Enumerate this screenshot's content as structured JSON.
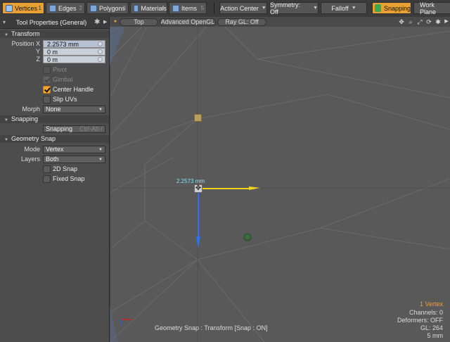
{
  "toolbar": {
    "tabs": [
      {
        "label": "Vertices",
        "num": "1"
      },
      {
        "label": "Edges",
        "num": "2"
      },
      {
        "label": "Polygons",
        "num": "3"
      },
      {
        "label": "Materials",
        "num": "4"
      },
      {
        "label": "Items",
        "num": "5"
      }
    ],
    "action_center": "Action Center",
    "symmetry": "Symmetry: Off",
    "falloff": "Falloff",
    "snapping": "Snapping",
    "work_plane": "Work Plane"
  },
  "panel": {
    "title": "Tool Properties (General)",
    "transform": {
      "header": "Transform",
      "position_x_label": "Position X",
      "position_x": "2.2573 mm",
      "y_label": "Y",
      "y": "0 m",
      "z_label": "Z",
      "z": "0 m",
      "pivot": "Pivot",
      "gimbal": "Gimbal",
      "center_handle": "Center Handle",
      "slip_uvs": "Slip UVs",
      "morph_label": "Morph",
      "morph_value": "None"
    },
    "snapping": {
      "header": "Snapping",
      "button": "Snapping",
      "shortcut": "Ctrl-Alt-/"
    },
    "geometry_snap": {
      "header": "Geometry Snap",
      "mode_label": "Mode",
      "mode_value": "Vertex",
      "layers_label": "Layers",
      "layers_value": "Both",
      "snap_2d": "2D Snap",
      "fixed_snap": "Fixed Snap"
    }
  },
  "viewport": {
    "view_top": "Top",
    "view_gl": "Advanced OpenGL",
    "view_raygl": "Ray GL: Off",
    "measure": "2.2573 mm",
    "status": "Geometry Snap : Transform  [Snap : ON]",
    "hud": {
      "selection": "1 Vertex",
      "channels": "Channels: 0",
      "deformers": "Deformers: OFF",
      "gl": "GL: 264",
      "grid": "5 mm"
    }
  },
  "colors": {
    "accent": "#e8a033",
    "x_axis": "#f2d21c",
    "z_axis": "#2f6fe8",
    "measure": "#7fe3ff"
  }
}
